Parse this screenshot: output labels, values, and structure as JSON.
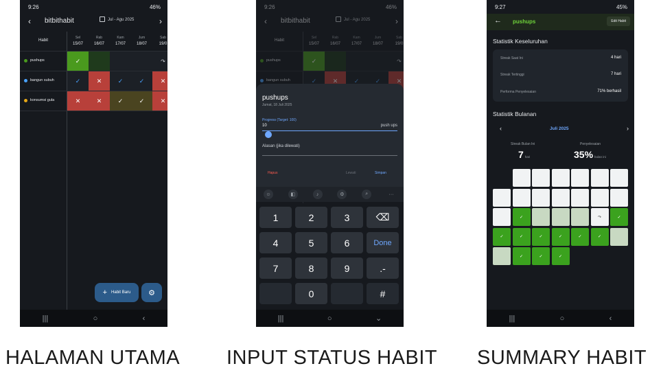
{
  "captions": [
    "HALAMAN UTAMA",
    "INPUT STATUS HABIT",
    "SUMMARY HABIT"
  ],
  "screen1": {
    "time": "9:26",
    "status_right": "46%",
    "title": "bitbithabit",
    "date_range": "Jul - Agu 2025",
    "habit_header": "Habit",
    "days": [
      {
        "dow": "Sel",
        "date": "15/07"
      },
      {
        "dow": "Rab",
        "date": "16/07"
      },
      {
        "dow": "Kam",
        "date": "17/07"
      },
      {
        "dow": "Jum",
        "date": "18/07"
      },
      {
        "dow": "Sab",
        "date": "19/0"
      }
    ],
    "habits": [
      {
        "name": "pushups",
        "color": "#4a9a1e",
        "cells": [
          "done",
          "empty-green",
          "empty",
          "empty",
          "skip"
        ]
      },
      {
        "name": "bangun subuh",
        "color": "#4aa3ff",
        "cells": [
          "blue-check",
          "red-x",
          "blue-check",
          "blue-check",
          "red-x"
        ]
      },
      {
        "name": "konsumsi gula",
        "color": "#e6a817",
        "cells": [
          "red-x",
          "red-x",
          "olive-check",
          "olive-check",
          "red-x"
        ]
      }
    ],
    "fab_label": "Habit Baru",
    "fab_icon": "plus-icon",
    "settings_icon": "gear-icon"
  },
  "screen2": {
    "time": "9:26",
    "status_right": "46%",
    "title": "bitbithabit",
    "date_range": "Jul - Agu 2025",
    "sheet": {
      "habit_name": "pushups",
      "date": "Jumat, 18 Juli 2025",
      "progress_label": "Progress (Target: 100)",
      "progress_value": "10",
      "progress_fraction": 0.1,
      "unit": "push ups",
      "reason_placeholder": "Alasan (jika dilewati)",
      "delete_label": "Hapus",
      "skip_label": "Lewati",
      "save_label": "Simpan"
    },
    "keys": [
      "1",
      "2",
      "3",
      "⌫",
      "4",
      "5",
      "6",
      "Done",
      "7",
      "8",
      "9",
      ".-",
      "",
      "0",
      "",
      "#"
    ]
  },
  "screen3": {
    "time": "9:27",
    "status_right": "45%",
    "title": "pushups",
    "edit_label": "Edit Habit",
    "overall_title": "Statistik Keseluruhan",
    "stats": [
      {
        "label": "Streak Saat Ini",
        "value": "4 hari"
      },
      {
        "label": "Streak Tertinggi",
        "value": "7 hari"
      },
      {
        "label": "Performa Penyelesaian",
        "value": "71% berhasil"
      }
    ],
    "monthly_title": "Statistik Bulanan",
    "month": "Juli 2025",
    "streak_label": "Streak Bulan Ini",
    "streak_value": "7",
    "streak_unit": "hari",
    "completion_label": "Penyelesaian",
    "completion_value": "35%",
    "completion_unit": "bulan ini",
    "calendar": [
      [
        "",
        "white",
        "white",
        "white",
        "white",
        "white",
        "white"
      ],
      [
        "white",
        "white",
        "white",
        "white",
        "white",
        "white",
        "white"
      ],
      [
        "white",
        "green",
        "light",
        "light",
        "light",
        "skip",
        "green"
      ],
      [
        "green",
        "green",
        "green",
        "green",
        "green",
        "green",
        "light"
      ],
      [
        "light",
        "green",
        "green",
        "green",
        "",
        "",
        ""
      ]
    ]
  }
}
